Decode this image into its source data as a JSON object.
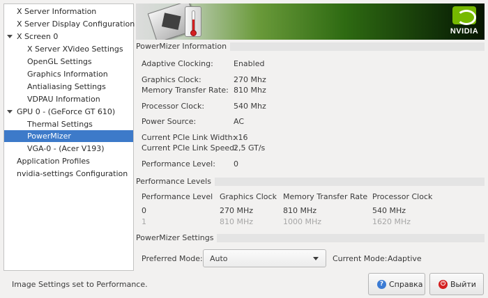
{
  "sidebar": {
    "items": [
      {
        "label": "X Server Information",
        "level": 0,
        "expander": false,
        "selected": false
      },
      {
        "label": "X Server Display Configuration",
        "level": 0,
        "expander": false,
        "selected": false
      },
      {
        "label": "X Screen 0",
        "level": 0,
        "expander": true,
        "selected": false
      },
      {
        "label": "X Server XVideo Settings",
        "level": 1,
        "expander": false,
        "selected": false
      },
      {
        "label": "OpenGL Settings",
        "level": 1,
        "expander": false,
        "selected": false
      },
      {
        "label": "Graphics Information",
        "level": 1,
        "expander": false,
        "selected": false
      },
      {
        "label": "Antialiasing Settings",
        "level": 1,
        "expander": false,
        "selected": false
      },
      {
        "label": "VDPAU Information",
        "level": 1,
        "expander": false,
        "selected": false
      },
      {
        "label": "GPU 0 - (GeForce GT 610)",
        "level": 0,
        "expander": true,
        "selected": false
      },
      {
        "label": "Thermal Settings",
        "level": 1,
        "expander": false,
        "selected": false
      },
      {
        "label": "PowerMizer",
        "level": 1,
        "expander": false,
        "selected": true
      },
      {
        "label": "VGA-0 - (Acer V193)",
        "level": 1,
        "expander": false,
        "selected": false
      },
      {
        "label": "Application Profiles",
        "level": 0,
        "expander": false,
        "selected": false
      },
      {
        "label": "nvidia-settings Configuration",
        "level": 0,
        "expander": false,
        "selected": false
      }
    ]
  },
  "banner": {
    "logo_text": "NVIDIA",
    "icons": [
      "graphics-card-icon",
      "thermometer-icon",
      "nvidia-logo-icon"
    ],
    "brand_color": "#76b900"
  },
  "powermizer_info": {
    "title": "PowerMizer Information",
    "adaptive_clocking_label": "Adaptive Clocking:",
    "adaptive_clocking_value": "Enabled",
    "graphics_clock_label": "Graphics Clock:",
    "graphics_clock_value": "270 Mhz",
    "memory_rate_label": "Memory Transfer Rate:",
    "memory_rate_value": "810 Mhz",
    "processor_clock_label": "Processor Clock:",
    "processor_clock_value": "540 Mhz",
    "power_source_label": "Power Source:",
    "power_source_value": "AC",
    "pcie_width_label": "Current PCIe Link Width:",
    "pcie_width_value": "x16",
    "pcie_speed_label": "Current PCIe Link Speed:",
    "pcie_speed_value": "2,5 GT/s",
    "perf_level_label": "Performance Level:",
    "perf_level_value": "0"
  },
  "performance_levels": {
    "title": "Performance Levels",
    "columns": [
      "Performance Level",
      "Graphics Clock",
      "Memory Transfer Rate",
      "Processor Clock"
    ],
    "rows": [
      [
        "0",
        "270 MHz",
        "810 MHz",
        "540 MHz"
      ],
      [
        "1",
        "810 MHz",
        "1000 MHz",
        "1620 MHz"
      ]
    ]
  },
  "powermizer_settings": {
    "title": "PowerMizer Settings",
    "preferred_mode_label": "Preferred Mode:",
    "preferred_mode_value": "Auto",
    "current_mode_label": "Current Mode:",
    "current_mode_value": "Adaptive"
  },
  "footer": {
    "status_text": "Image Settings set to Performance.",
    "help_label": "Справка",
    "quit_label": "Выйти",
    "help_icon_color": "#3b7bd4",
    "quit_icon_color": "#d42020"
  },
  "colors": {
    "selection": "#3d7ac9",
    "window_bg": "#f2f1f0"
  }
}
